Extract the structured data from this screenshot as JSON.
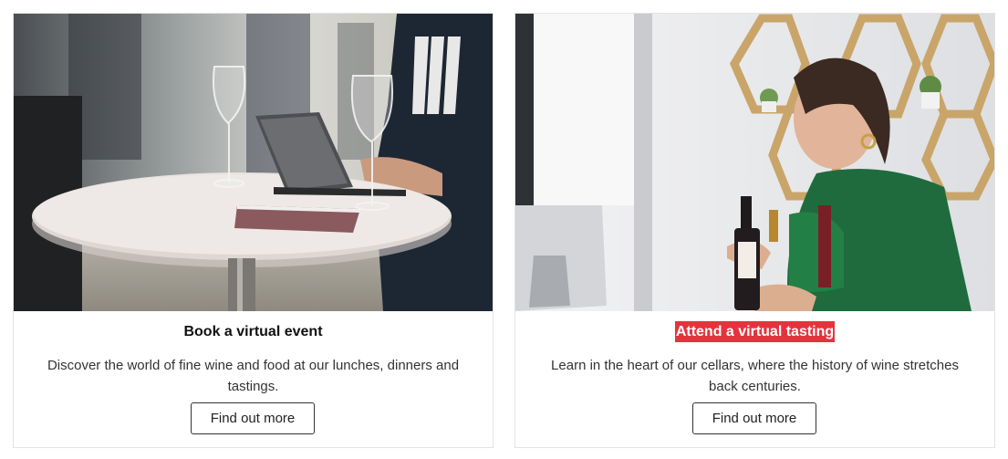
{
  "cards": [
    {
      "image_alt": "Wine glasses and a tablet on a round standing table at an event",
      "title": "Book a virtual event",
      "description": "Discover the world of fine wine and food at our lunches, dinners and tastings.",
      "button_label": "Find out more"
    },
    {
      "image_alt": "Woman in green dress presenting a bottle of wine in front of hexagonal shelves",
      "title": "Attend a virtual tasting",
      "description": "Learn in the heart of our cellars, where the history of wine stretches back centuries.",
      "button_label": "Find out more"
    }
  ],
  "colors": {
    "highlight": "#e3343e",
    "border": "#e3e3e3",
    "text": "#333333"
  }
}
